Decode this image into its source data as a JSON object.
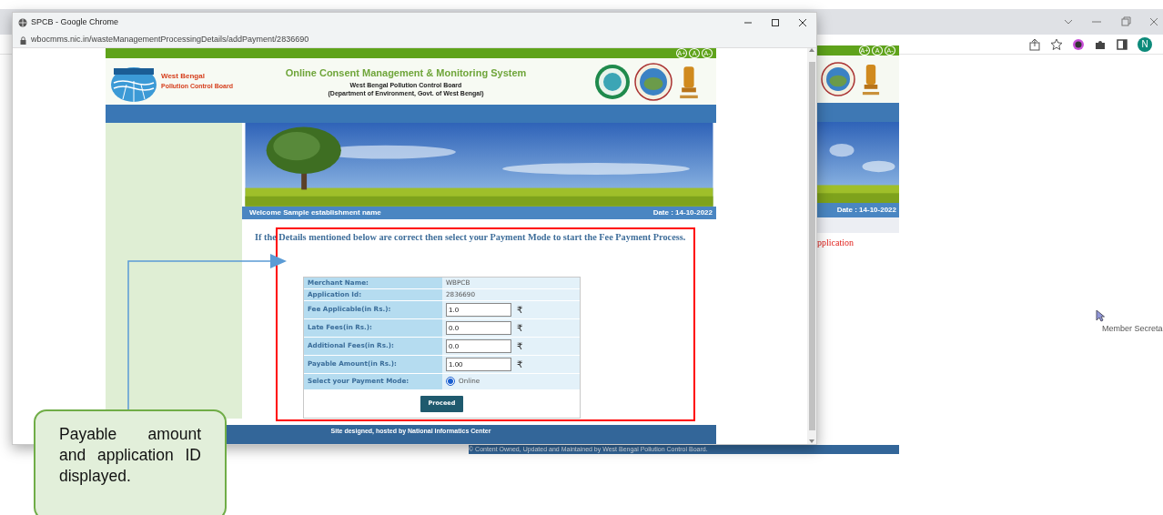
{
  "background_window": {
    "profile_initial": "N",
    "page": {
      "font_size_buttons": [
        "A+",
        "A",
        "A-"
      ],
      "date": "Date : 14-10-2022",
      "notice": "pplication",
      "footer": "© Content Owned, Updated and Maintained by West Bengal Pollution Control Board."
    },
    "tooltip": "Member Secreta"
  },
  "popup_window": {
    "title": "SPCB - Google Chrome",
    "url": "wbocmms.nic.in/wasteManagementProcessingDetails/addPayment/2836690",
    "page": {
      "font_size_buttons": [
        "A+",
        "A",
        "A-"
      ],
      "org_name": "West Bengal",
      "org_subtitle": "Pollution Control Board",
      "site_title": "Online Consent Management & Monitoring System",
      "board": "West Bengal Pollution Control Board",
      "department": "(Department of Environment, Govt. of West Bengal)",
      "welcome": "Welcome Sample establishment name",
      "date": "Date : 14-10-2022",
      "instruction": "If the Details mentioned below are correct then select your Payment Mode to start the Fee Payment Process.",
      "form": {
        "rows": [
          {
            "kind": "text",
            "label": "Merchant Name:",
            "value": "WBPCB"
          },
          {
            "kind": "text",
            "label": "Application Id:",
            "value": "2836690"
          },
          {
            "kind": "amount",
            "label": "Fee Applicable(in Rs.):",
            "value": "1.0",
            "currency": "₹"
          },
          {
            "kind": "amount",
            "label": "Late Fees(in Rs.):",
            "value": "0.0",
            "currency": "₹"
          },
          {
            "kind": "amount",
            "label": "Additional Fees(in Rs.):",
            "value": "0.0",
            "currency": "₹"
          },
          {
            "kind": "amount",
            "label": "Payable Amount(in Rs.):",
            "value": "1.00",
            "currency": "₹"
          },
          {
            "kind": "radio",
            "label": "Select your Payment Mode:",
            "option": "Online",
            "selected": true
          }
        ],
        "submit": "Proceed"
      },
      "footer": "Site designed, hosted by National Informatics Center"
    }
  },
  "annotation": {
    "callout": "Payable amount and application ID displayed."
  }
}
